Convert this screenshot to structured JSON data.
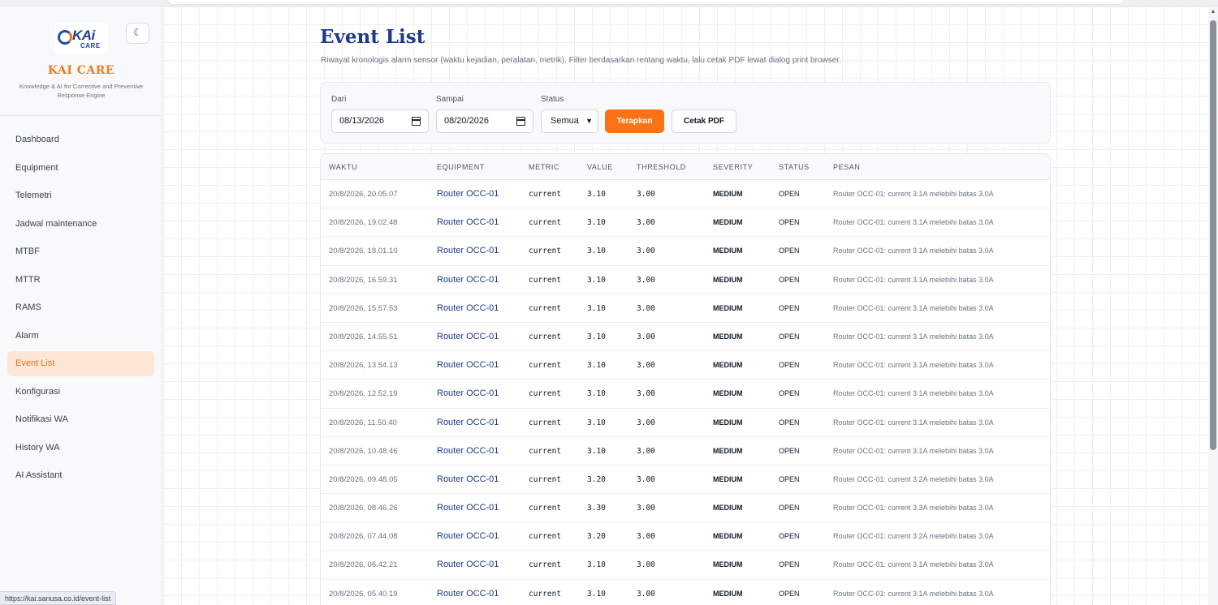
{
  "app": {
    "logo_text": "KAi",
    "logo_sub": "CARE",
    "name": "KAI CARE",
    "tagline": "Knowledge & AI for Corrective and Preventive Response Engine"
  },
  "sidebar": {
    "items": [
      {
        "label": "Dashboard"
      },
      {
        "label": "Equipment"
      },
      {
        "label": "Telemetri"
      },
      {
        "label": "Jadwal maintenance"
      },
      {
        "label": "MTBF"
      },
      {
        "label": "MTTR"
      },
      {
        "label": "RAMS"
      },
      {
        "label": "Alarm"
      },
      {
        "label": "Event List",
        "active": true
      },
      {
        "label": "Konfigurasi"
      },
      {
        "label": "Notifikasi WA"
      },
      {
        "label": "History WA"
      },
      {
        "label": "AI Assistant"
      }
    ]
  },
  "status_url": "https://kai.sanusa.co.id/event-list",
  "page": {
    "title": "Event List",
    "description": "Riwayat kronologis alarm sensor (waktu kejadian, peralatan, metrik). Filter berdasarkan rentang waktu, lalu cetak PDF lewat dialog print browser."
  },
  "filters": {
    "from_label": "Dari",
    "from_value": "08/13/2026",
    "to_label": "Sampai",
    "to_value": "08/20/2026",
    "status_label": "Status",
    "status_value": "Semua",
    "apply_label": "Terapkan",
    "print_label": "Cetak PDF"
  },
  "table": {
    "headers": {
      "time": "WAKTU",
      "equipment": "EQUIPMENT",
      "metric": "METRIC",
      "value": "VALUE",
      "threshold": "THRESHOLD",
      "severity": "SEVERITY",
      "status": "STATUS",
      "message": "PESAN"
    },
    "rows": [
      {
        "time": "20/8/2026, 20.05.07",
        "equipment": "Router OCC-01",
        "metric": "current",
        "value": "3.10",
        "threshold": "3.00",
        "severity": "MEDIUM",
        "status": "OPEN",
        "message": "Router OCC-01: current 3.1A melebihi batas 3.0A"
      },
      {
        "time": "20/8/2026, 19.02.48",
        "equipment": "Router OCC-01",
        "metric": "current",
        "value": "3.10",
        "threshold": "3.00",
        "severity": "MEDIUM",
        "status": "OPEN",
        "message": "Router OCC-01: current 3.1A melebihi batas 3.0A"
      },
      {
        "time": "20/8/2026, 18.01.10",
        "equipment": "Router OCC-01",
        "metric": "current",
        "value": "3.10",
        "threshold": "3.00",
        "severity": "MEDIUM",
        "status": "OPEN",
        "message": "Router OCC-01: current 3.1A melebihi batas 3.0A"
      },
      {
        "time": "20/8/2026, 16.59.31",
        "equipment": "Router OCC-01",
        "metric": "current",
        "value": "3.10",
        "threshold": "3.00",
        "severity": "MEDIUM",
        "status": "OPEN",
        "message": "Router OCC-01: current 3.1A melebihi batas 3.0A"
      },
      {
        "time": "20/8/2026, 15.57.53",
        "equipment": "Router OCC-01",
        "metric": "current",
        "value": "3.10",
        "threshold": "3.00",
        "severity": "MEDIUM",
        "status": "OPEN",
        "message": "Router OCC-01: current 3.1A melebihi batas 3.0A"
      },
      {
        "time": "20/8/2026, 14.55.51",
        "equipment": "Router OCC-01",
        "metric": "current",
        "value": "3.10",
        "threshold": "3.00",
        "severity": "MEDIUM",
        "status": "OPEN",
        "message": "Router OCC-01: current 3.1A melebihi batas 3.0A"
      },
      {
        "time": "20/8/2026, 13.54.13",
        "equipment": "Router OCC-01",
        "metric": "current",
        "value": "3.10",
        "threshold": "3.00",
        "severity": "MEDIUM",
        "status": "OPEN",
        "message": "Router OCC-01: current 3.1A melebihi batas 3.0A"
      },
      {
        "time": "20/8/2026, 12.52.19",
        "equipment": "Router OCC-01",
        "metric": "current",
        "value": "3.10",
        "threshold": "3.00",
        "severity": "MEDIUM",
        "status": "OPEN",
        "message": "Router OCC-01: current 3.1A melebihi batas 3.0A"
      },
      {
        "time": "20/8/2026, 11.50.40",
        "equipment": "Router OCC-01",
        "metric": "current",
        "value": "3.10",
        "threshold": "3.00",
        "severity": "MEDIUM",
        "status": "OPEN",
        "message": "Router OCC-01: current 3.1A melebihi batas 3.0A"
      },
      {
        "time": "20/8/2026, 10.48.46",
        "equipment": "Router OCC-01",
        "metric": "current",
        "value": "3.10",
        "threshold": "3.00",
        "severity": "MEDIUM",
        "status": "OPEN",
        "message": "Router OCC-01: current 3.1A melebihi batas 3.0A"
      },
      {
        "time": "20/8/2026, 09.48.05",
        "equipment": "Router OCC-01",
        "metric": "current",
        "value": "3.20",
        "threshold": "3.00",
        "severity": "MEDIUM",
        "status": "OPEN",
        "message": "Router OCC-01: current 3.2A melebihi batas 3.0A"
      },
      {
        "time": "20/8/2026, 08.46.26",
        "equipment": "Router OCC-01",
        "metric": "current",
        "value": "3.30",
        "threshold": "3.00",
        "severity": "MEDIUM",
        "status": "OPEN",
        "message": "Router OCC-01: current 3.3A melebihi batas 3.0A"
      },
      {
        "time": "20/8/2026, 07.44.08",
        "equipment": "Router OCC-01",
        "metric": "current",
        "value": "3.20",
        "threshold": "3.00",
        "severity": "MEDIUM",
        "status": "OPEN",
        "message": "Router OCC-01: current 3.2A melebihi batas 3.0A"
      },
      {
        "time": "20/8/2026, 06.42.21",
        "equipment": "Router OCC-01",
        "metric": "current",
        "value": "3.10",
        "threshold": "3.00",
        "severity": "MEDIUM",
        "status": "OPEN",
        "message": "Router OCC-01: current 3.1A melebihi batas 3.0A"
      },
      {
        "time": "20/8/2026, 05.40.19",
        "equipment": "Router OCC-01",
        "metric": "current",
        "value": "3.10",
        "threshold": "3.00",
        "severity": "MEDIUM",
        "status": "OPEN",
        "message": "Router OCC-01: current 3.1A melebihi batas 3.0A"
      }
    ]
  },
  "icons": {
    "theme_toggle": "moon-icon",
    "date_picker": "calendar-icon",
    "select": "chevron-down-icon"
  },
  "colors": {
    "accent": "#f97316",
    "brand_blue": "#1e3a8a",
    "active_nav_bg": "#fde6d6"
  }
}
